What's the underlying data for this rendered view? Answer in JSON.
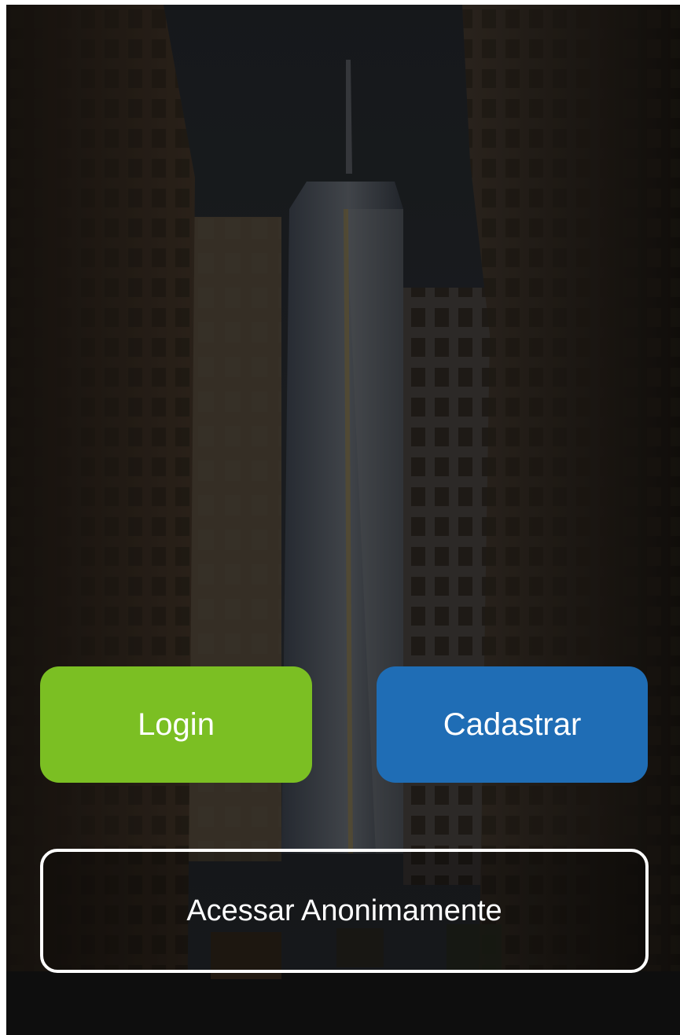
{
  "actions": {
    "login_label": "Login",
    "register_label": "Cadastrar",
    "anonymous_label": "Acessar Anonimamente"
  },
  "colors": {
    "login": "#7bbf23",
    "register": "#1f6db5",
    "outline": "#ffffff",
    "text": "#ffffff"
  }
}
